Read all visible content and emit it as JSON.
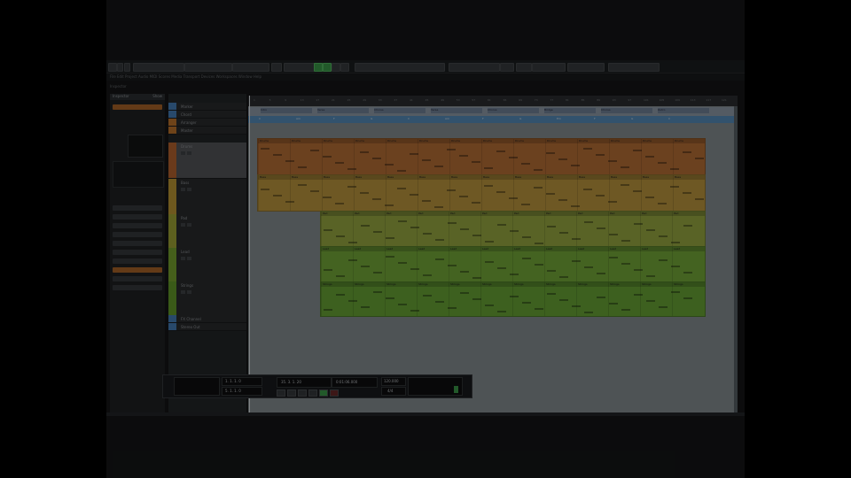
{
  "app": {
    "title": "Cubase"
  },
  "subbar_text": "File Edit Project Audio MIDI Scores Media Transport Devices Workspaces Window Help",
  "subbar2_text": "Inspector",
  "inspector": {
    "header": "Inspector",
    "header_right": "Show",
    "section_rows": [
      "",
      "",
      "",
      "",
      "",
      "",
      "",
      "",
      "",
      ""
    ]
  },
  "tracks": [
    {
      "name": "Marker",
      "color": "#4a86c4"
    },
    {
      "name": "Chord",
      "color": "#4a86c4"
    },
    {
      "name": "Arranger",
      "color": "#c87b2e"
    },
    {
      "name": "Master",
      "color": "#c87b2e"
    },
    {
      "name": "Drums",
      "color": "#c26a32"
    },
    {
      "name": "Bass",
      "color": "#c9a037"
    },
    {
      "name": "Pad",
      "color": "#a9b03a"
    },
    {
      "name": "Lead",
      "color": "#7fae32"
    },
    {
      "name": "Strings",
      "color": "#6aa52d"
    },
    {
      "name": "FX Channel",
      "color": "#4a86c4"
    },
    {
      "name": "Stereo Out",
      "color": "#4a86c4"
    }
  ],
  "ruler": [
    "1",
    "5",
    "9",
    "13",
    "17",
    "21",
    "25",
    "29",
    "33",
    "37",
    "41",
    "45",
    "49",
    "53",
    "57",
    "61",
    "65",
    "69",
    "73",
    "77",
    "81",
    "85",
    "89",
    "93",
    "97",
    "101",
    "105",
    "109",
    "113",
    "117",
    "121"
  ],
  "marker_lane": [
    "Intro",
    "Verse",
    "Chorus",
    "Verse",
    "Chorus",
    "Bridge",
    "Chorus",
    "Outro"
  ],
  "chord_lane": [
    "C",
    "Am",
    "F",
    "G",
    "C",
    "Am",
    "F",
    "G",
    "Em",
    "F",
    "G",
    "C"
  ],
  "parts": [
    {
      "name": "Drums",
      "color": "#c4773a"
    },
    {
      "name": "Bass",
      "color": "#c8a043"
    },
    {
      "name": "Pad",
      "color": "#a2b446"
    },
    {
      "name": "Lead",
      "color": "#7db53d"
    },
    {
      "name": "Strings",
      "color": "#6fb039"
    }
  ],
  "transport": {
    "left_locator": "1. 1. 1. 0",
    "right_locator": "5. 1. 1. 0",
    "position": "35. 3. 1. 20",
    "time": "0:01:06.000",
    "tempo": "120.000",
    "signature": "4/4"
  },
  "colors": {
    "accent_green": "#3fa34d",
    "accent_orange": "#c87b2e",
    "accent_blue": "#4a86c4"
  }
}
